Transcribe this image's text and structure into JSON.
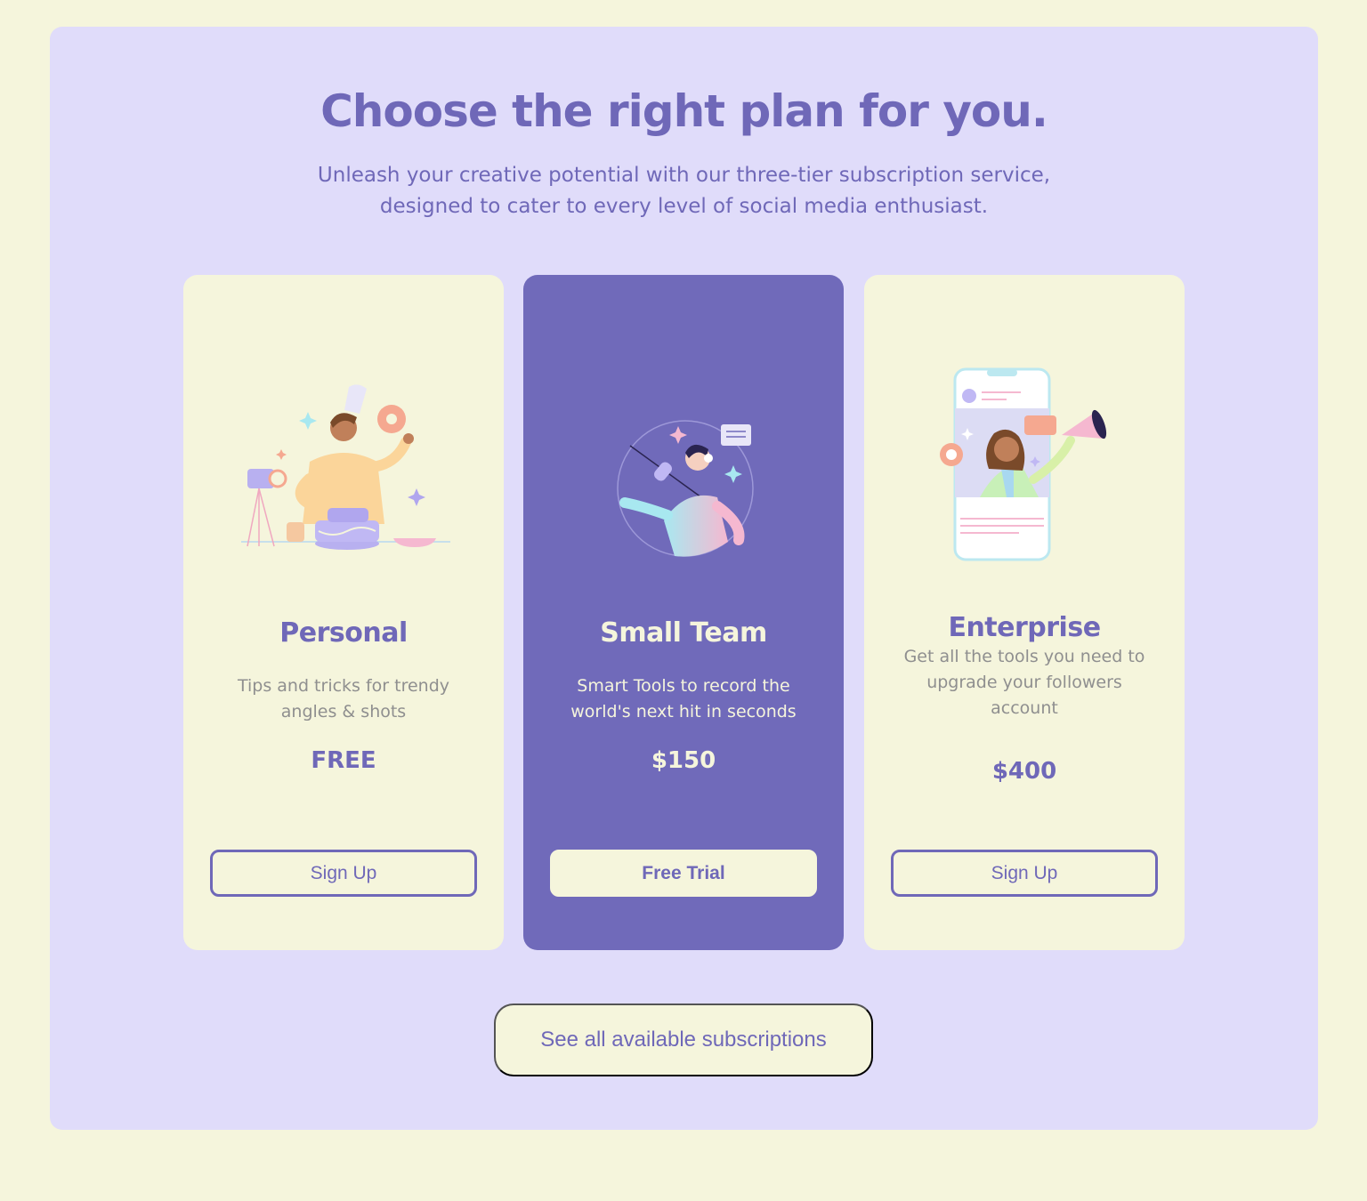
{
  "header": {
    "title": "Choose the right plan for you.",
    "subtitle": "Unleash your creative potential with our three-tier subscription service, designed to cater to every level of social media enthusiast."
  },
  "plans": [
    {
      "name": "Personal",
      "description": "Tips and tricks for trendy angles & shots",
      "price": "FREE",
      "button": "Sign Up",
      "illustration": "chef-baking-illustration"
    },
    {
      "name": "Small Team",
      "description": "Smart Tools to record the world's next hit in seconds",
      "price": "$150",
      "button": "Free Trial",
      "illustration": "podcaster-illustration"
    },
    {
      "name": "Enterprise",
      "description": "Get all the tools you need to upgrade your followers account",
      "price": "$400",
      "button": "Sign Up",
      "illustration": "phone-influencer-illustration"
    }
  ],
  "footer": {
    "see_all_label": "See all available subscriptions"
  },
  "colors": {
    "page_background": "#f5f5dc",
    "panel_background": "#e0dcfa",
    "accent": "#706aba",
    "muted_text": "#8f8f8f"
  }
}
